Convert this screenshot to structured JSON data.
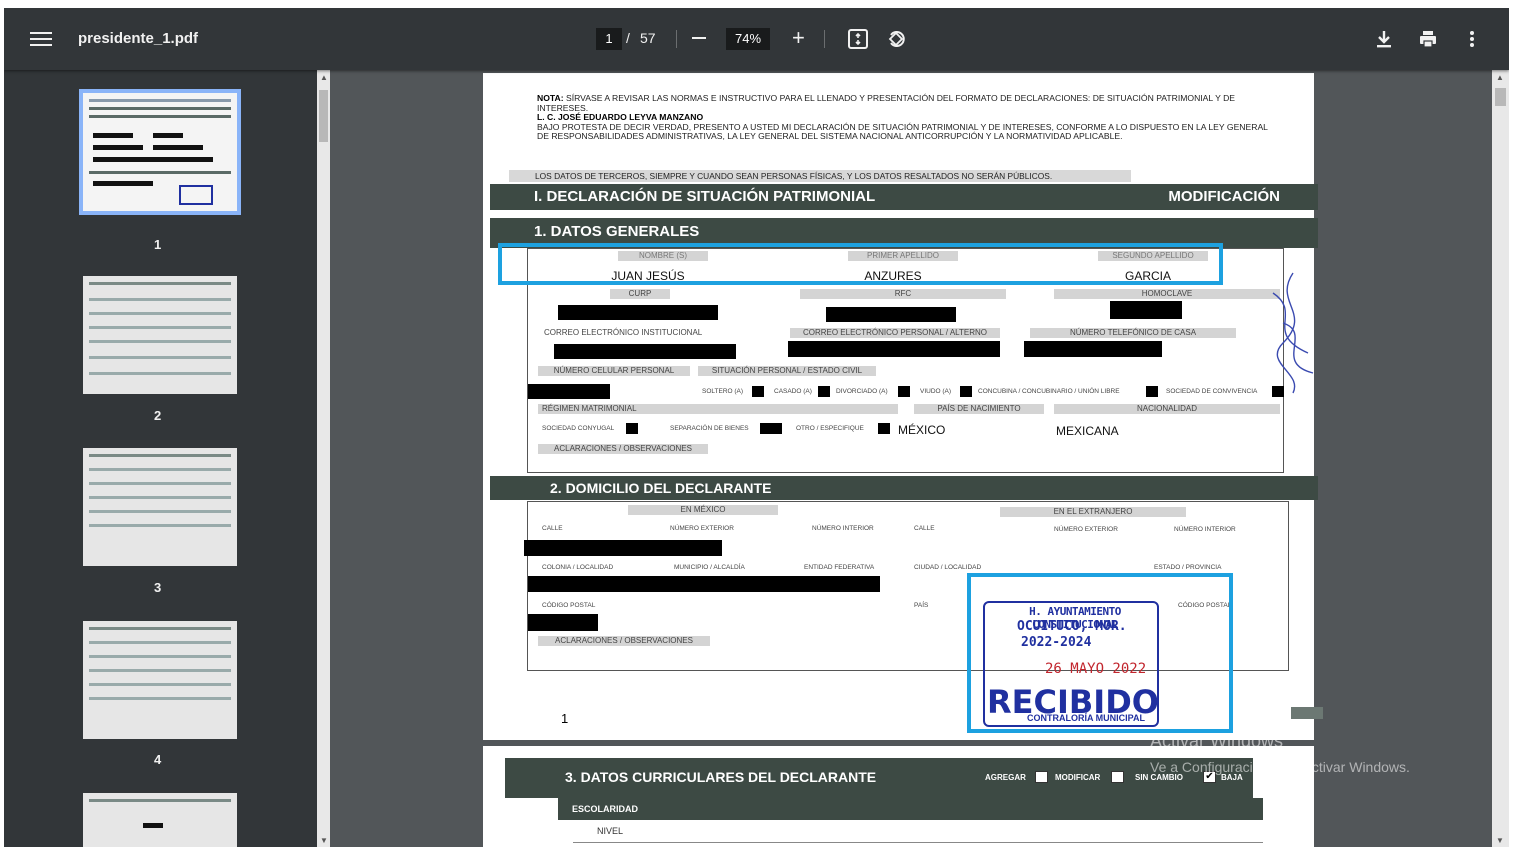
{
  "toolbar": {
    "file_name": "presidente_1.pdf",
    "current_page": "1",
    "page_sep": "/",
    "total_pages": "57",
    "zoom": "74%",
    "icons": [
      "menu-icon",
      "zoom-out-icon",
      "zoom-in-icon",
      "fit-page-icon",
      "rotate-icon",
      "download-icon",
      "print-icon",
      "more-options-icon"
    ]
  },
  "sidebar": {
    "thumbnails": [
      {
        "label": "1"
      },
      {
        "label": "2"
      },
      {
        "label": "3"
      },
      {
        "label": "4"
      }
    ]
  },
  "page1": {
    "nota_label": "NOTA:",
    "nota_text": "SÍRVASE A REVISAR LAS NORMAS E INSTRUCTIVO PARA EL LLENADO Y PRESENTACIÓN DEL FORMATO DE DECLARACIONES: DE SITUACIÓN PATRIMONIAL Y DE INTERESES.",
    "addressee": "L. C. JOSÉ EDUARDO LEYVA MANZANO",
    "protesta": "BAJO PROTESTA DE DECIR VERDAD, PRESENTO A USTED MI DECLARACIÓN DE SITUACIÓN PATRIMONIAL Y DE INTERESES, CONFORME A LO DISPUESTO EN LA LEY GENERAL DE RESPONSABILIDADES ADMINISTRATIVAS, LA LEY GENERAL DEL SISTEMA NACIONAL ANTICORRUPCIÓN Y LA NORMATIVIDAD APLICABLE.",
    "privacy": "LOS DATOS DE TERCEROS, SIEMPRE Y CUANDO SEAN PERSONAS FÍSICAS, Y LOS DATOS RESALTADOS NO SERÁN PÚBLICOS.",
    "section_title": "I. DECLARACIÓN DE SITUACIÓN PATRIMONIAL",
    "section_type": "MODIFICACIÓN",
    "datos_generales": "1. DATOS GENERALES",
    "labels": {
      "nombre": "NOMBRE (S)",
      "primer_apellido": "PRIMER APELLIDO",
      "segundo_apellido": "SEGUNDO APELLIDO",
      "curp": "CURP",
      "rfc": "RFC",
      "homoclave": "HOMOCLAVE",
      "correo_inst": "CORREO ELECTRÓNICO INSTITUCIONAL",
      "correo_pers": "CORREO ELECTRÓNICO PERSONAL / ALTERNO",
      "tel_casa": "NÚMERO TELEFÓNICO DE CASA",
      "celular": "NÚMERO CELULAR PERSONAL",
      "situacion": "SITUACIÓN PERSONAL / ESTADO CIVIL",
      "soltero": "SOLTERO (A)",
      "casado": "CASADO (A)",
      "divorciado": "DIVORCIADO (A)",
      "viudo": "VIUDO (A)",
      "concubina": "CONCUBINA / CONCUBINARIO / UNIÓN LIBRE",
      "sociedad_conv": "SOCIEDAD DE CONVIVENCIA",
      "regimen": "RÉGIMEN MATRIMONIAL",
      "pais_nac": "PAÍS DE NACIMIENTO",
      "nacionalidad": "NACIONALIDAD",
      "soc_conyugal": "SOCIEDAD CONYUGAL",
      "separacion": "SEPARACIÓN DE BIENES",
      "otro": "OTRO / ESPECIFIQUE",
      "aclaraciones": "ACLARACIONES / OBSERVACIONES"
    },
    "values": {
      "nombre": "JUAN JESÚS",
      "primer_apellido": "ANZURES",
      "segundo_apellido": "GARCIA",
      "pais": "MÉXICO",
      "nacionalidad": "MEXICANA"
    },
    "domicilio_title": "2. DOMICILIO DEL DECLARANTE",
    "domicilio": {
      "en_mexico": "EN MÉXICO",
      "en_extranjero": "EN EL EXTRANJERO",
      "calle": "CALLE",
      "num_ext": "NÚMERO EXTERIOR",
      "num_int": "NÚMERO INTERIOR",
      "colonia": "COLONIA / LOCALIDAD",
      "municipio": "MUNICIPIO / ALCALDÍA",
      "entidad": "ENTIDAD FEDERATIVA",
      "ciudad": "CIUDAD / LOCALIDAD",
      "estado": "ESTADO / PROVINCIA",
      "cp": "CÓDIGO POSTAL",
      "pais": "PAÍS",
      "aclaraciones": "ACLARACIONES / OBSERVACIONES"
    },
    "stamp": {
      "line1": "H. AYUNTAMIENTO CONSTITUCIONAL",
      "line2": "OCUITUCO, MOR.",
      "line3": "2022-2024",
      "date": "26 MAYO 2022",
      "recibido": "RECIBIDO",
      "contraloria": "CONTRALORÍA MUNICIPAL"
    },
    "page_number": "1"
  },
  "page2": {
    "title": "3. DATOS CURRICULARES DEL DECLARANTE",
    "options": [
      "AGREGAR",
      "MODIFICAR",
      "SIN CAMBIO",
      "BAJA"
    ],
    "checked_option": "SIN CAMBIO",
    "escolaridad": "ESCOLARIDAD",
    "nivel": "NIVEL"
  },
  "watermark": {
    "line1": "Activar Windows",
    "line2": "Ve a Configuración para activar Windows."
  },
  "colors": {
    "toolbar": "#323639",
    "viewer_bg": "#525659",
    "section_band": "#3d4a44",
    "highlight": "#1da1e0",
    "stamp_blue": "#2030a0",
    "stamp_red": "#c2262e"
  }
}
